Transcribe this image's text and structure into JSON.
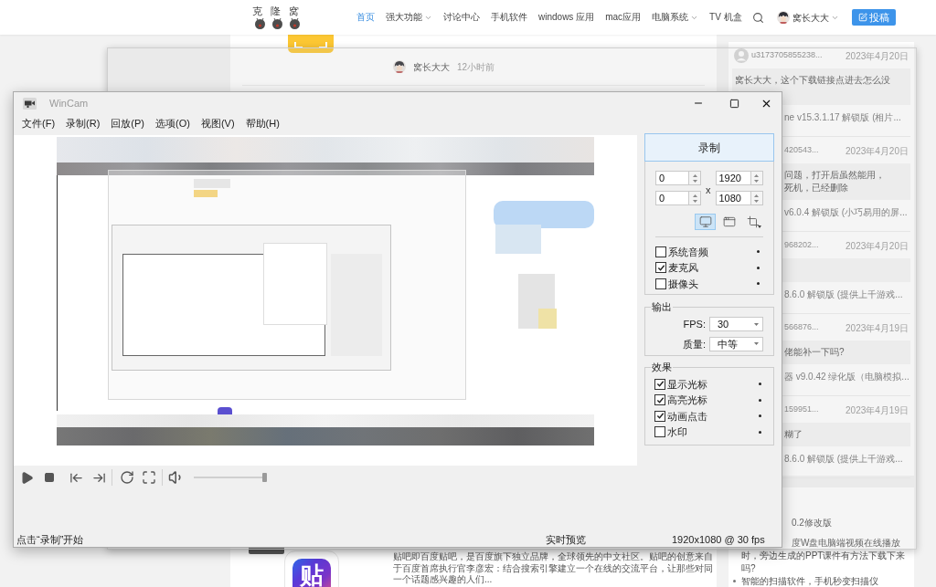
{
  "site_header": {
    "logo_text": "克 隆 窝",
    "nav": [
      {
        "label": "首页",
        "selected": true,
        "has_menu": false
      },
      {
        "label": "强大功能",
        "selected": false,
        "has_menu": true
      },
      {
        "label": "讨论中心",
        "selected": false,
        "has_menu": false
      },
      {
        "label": "手机软件",
        "selected": false,
        "has_menu": false
      },
      {
        "label": "windows 应用",
        "selected": false,
        "has_menu": false
      },
      {
        "label": "mac应用",
        "selected": false,
        "has_menu": false
      },
      {
        "label": "电脑系统",
        "selected": false,
        "has_menu": true
      },
      {
        "label": "TV 机盒",
        "selected": false,
        "has_menu": false
      }
    ],
    "user_name": "窝长大大",
    "post_button": "投稿"
  },
  "article": {
    "author": "窝长大大",
    "time": "12小时前",
    "logo_text": "贴",
    "excerpt": "贴吧即百度贴吧，是百度旗下独立品牌，全球领先的中文社区。贴吧的创意来自于百度首席执行官李彦宏：结合搜索引擎建立一个在线的交流平台，让那些对同一个话题感兴趣的人们..."
  },
  "sidebar": {
    "comments": [
      {
        "kind": "whole",
        "user": "u3173705855238...",
        "date": "2023年4月20日",
        "text_lines": [
          "窝长大大，这个下载链接点进去怎么没"
        ],
        "post": "ne v15.3.1.17 解锁版 (相片..."
      },
      {
        "kind": "cut",
        "user": "420543...",
        "date": "2023年4月20日",
        "text_lines": [
          "问题，打开后虽然能用，",
          "死机，已经删除"
        ],
        "post": "v6.0.4 解锁版 (小巧易用的屏..."
      },
      {
        "kind": "cut",
        "user": "968202...",
        "date": "2023年4月20日",
        "post": "8.6.0 解锁版 (提供上千游戏..."
      },
      {
        "kind": "cut",
        "user": "566876...",
        "date": "2023年4月19日",
        "text_lines": [
          "佬能补一下吗?"
        ],
        "post": "器 v9.0.42 绿化版（电脑模拟..."
      },
      {
        "kind": "cut",
        "user": "159951...",
        "date": "2023年4月19日",
        "text_lines": [
          "糊了"
        ],
        "post": "8.6.0 解锁版 (提供上千游戏..."
      }
    ],
    "list_fragments": [
      {
        "kind": "continuation",
        "text": "0.2修改版"
      },
      {
        "kind": "continuation",
        "text": "度W盘电脑端视频在线播放"
      },
      {
        "kind": "wrapped",
        "text": "时，旁边生成的PPT课件有方法下载下来"
      },
      {
        "kind": "wrapped",
        "text": "吗?"
      },
      {
        "kind": "bullet",
        "text": "智能的扫描软件，手机秒变扫描仪"
      }
    ]
  },
  "wincam": {
    "title": "WinCam",
    "menu": [
      "文件(F)",
      "录制(R)",
      "回放(P)",
      "选项(O)",
      "视图(V)",
      "帮助(H)"
    ],
    "record_button": "录制",
    "region_fields": [
      "0",
      "1920",
      "0",
      "1080"
    ],
    "region_separator": "x",
    "capture_modes": [
      {
        "kind": "screen",
        "selected": true
      },
      {
        "kind": "window",
        "selected": false
      },
      {
        "kind": "region",
        "selected": false
      }
    ],
    "sources": [
      {
        "label": "系统音频",
        "checked": false
      },
      {
        "label": "麦克风",
        "checked": true
      },
      {
        "label": "摄像头",
        "checked": false
      }
    ],
    "output": {
      "title": "输出",
      "fps_label": "FPS:",
      "fps": "30",
      "quality_label": "质量:",
      "quality": "中等"
    },
    "effects": {
      "title": "效果",
      "options": [
        {
          "label": "显示光标",
          "checked": true
        },
        {
          "label": "高亮光标",
          "checked": true
        },
        {
          "label": "动画点击",
          "checked": true
        },
        {
          "label": "水印",
          "checked": false
        }
      ]
    },
    "volume": {
      "level": 1
    },
    "status_bar": {
      "hint": "点击“录制”开始",
      "mode": "实时预览",
      "format": "1920x1080 @ 30 fps"
    }
  }
}
